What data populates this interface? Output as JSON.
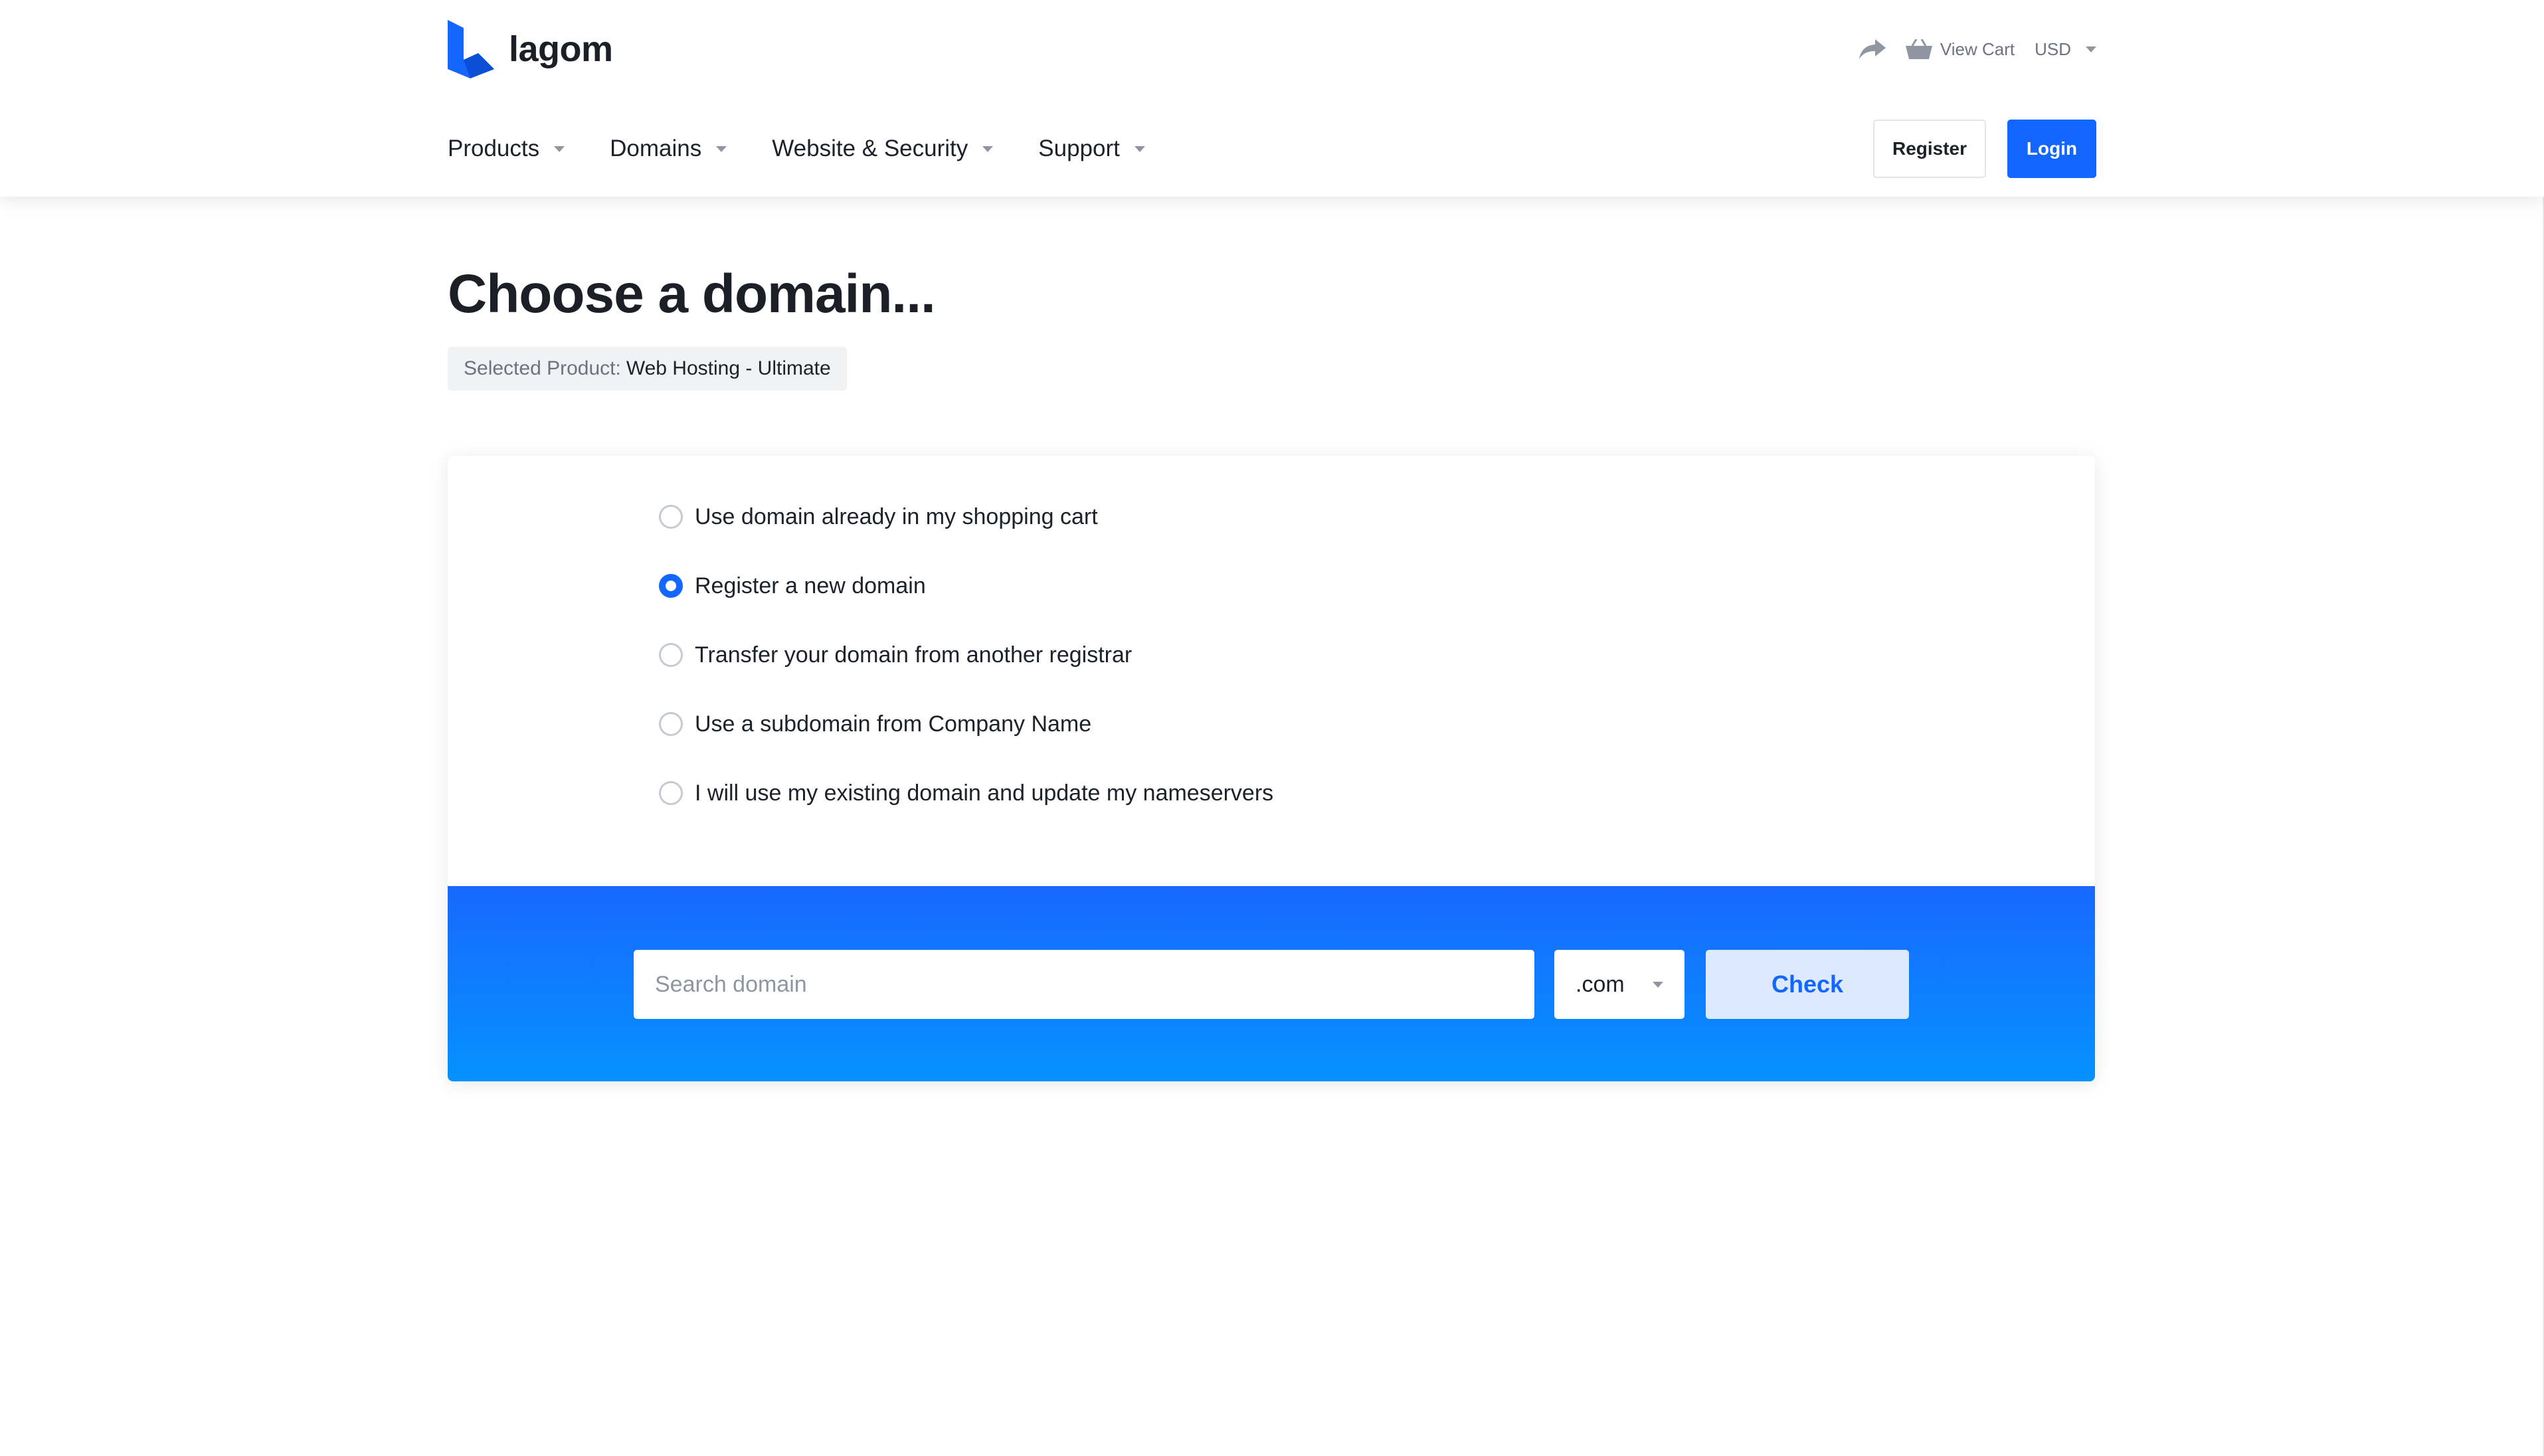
{
  "brand": {
    "name": "lagom",
    "accent_color": "#1366ff"
  },
  "topbar": {
    "share_icon": "share-arrow-icon",
    "cart_icon": "basket-icon",
    "view_cart_label": "View Cart",
    "currency": "USD"
  },
  "nav": {
    "items": [
      {
        "label": "Products"
      },
      {
        "label": "Domains"
      },
      {
        "label": "Website & Security"
      },
      {
        "label": "Support"
      }
    ]
  },
  "auth": {
    "register_label": "Register",
    "login_label": "Login"
  },
  "main": {
    "title": "Choose a domain...",
    "selected_product_key": "Selected Product:",
    "selected_product_value": "Web Hosting - Ultimate"
  },
  "domain_options": {
    "selected_index": 1,
    "items": [
      {
        "label": "Use domain already in my shopping cart",
        "checked": false
      },
      {
        "label": "Register a new domain",
        "checked": true
      },
      {
        "label": "Transfer your domain from another registrar",
        "checked": false
      },
      {
        "label": "Use a subdomain from Company Name",
        "checked": false
      },
      {
        "label": "I will use my existing domain and update my nameservers",
        "checked": false
      }
    ]
  },
  "search": {
    "placeholder": "Search domain",
    "value": "",
    "tld_selected": ".com",
    "check_label": "Check"
  }
}
